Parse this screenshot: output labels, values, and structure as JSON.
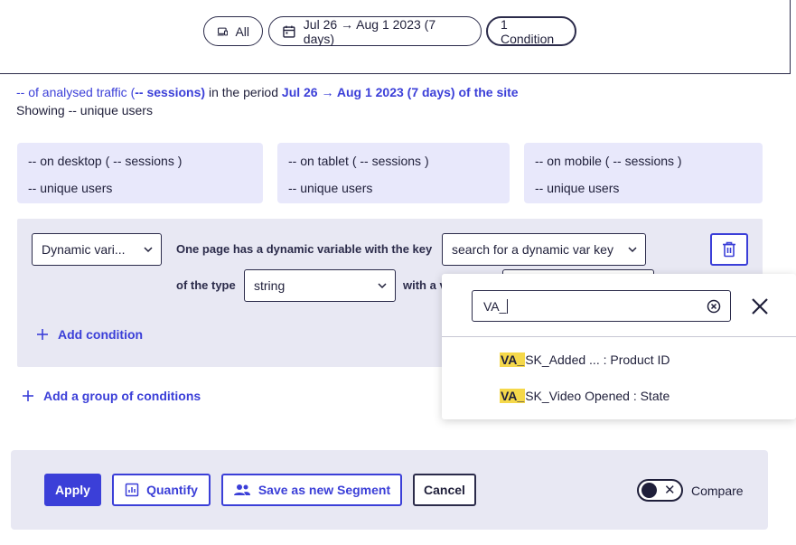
{
  "filters": {
    "device_label": "All",
    "date_label": "Jul 26 → Aug 1 2023 (7 days)",
    "condition_label": "1 Condition"
  },
  "summary": {
    "traffic_prefix": "-- of analysed traffic (",
    "sessions": "-- sessions)",
    "period_text": " in the period ",
    "period": "Jul 26 → Aug 1 2023 (7 days) of the site",
    "showing_prefix": "Showing ",
    "unique_users": "-- unique users"
  },
  "devices": [
    {
      "title": "-- on desktop ( -- sessions )",
      "users": "-- unique users"
    },
    {
      "title": "-- on tablet ( -- sessions )",
      "users": "-- unique users"
    },
    {
      "title": "-- on mobile ( -- sessions )",
      "users": "-- unique users"
    }
  ],
  "condition": {
    "type_select": "Dynamic vari...",
    "key_label": "One page has a dynamic variable with the key",
    "key_select": "search for a dynamic var key",
    "type_label": "of the type",
    "datatype_select": "string",
    "value_label": "with a v",
    "add_condition": "Add condition"
  },
  "add_group": "Add a group of conditions",
  "actions": {
    "apply": "Apply",
    "quantify": "Quantify",
    "save_segment": "Save as new Segment",
    "cancel": "Cancel",
    "compare": "Compare"
  },
  "popover": {
    "search_value": "VA_",
    "options": [
      {
        "match": "VA_",
        "rest": "SK_Added ... : Product ID"
      },
      {
        "match": "VA_",
        "rest": "SK_Video Opened : State"
      }
    ]
  },
  "colors": {
    "accent": "#3b3fd8",
    "highlight": "#f5d84a",
    "panel": "#e8e8f3"
  }
}
